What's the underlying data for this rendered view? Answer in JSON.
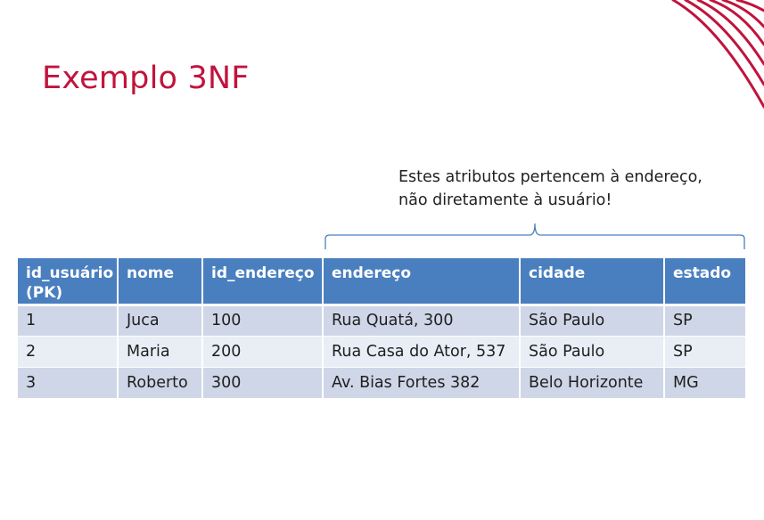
{
  "slide": {
    "title": "Exemplo 3NF",
    "annotation_lines": [
      "Estes atributos pertencem à endereço,",
      "não diretamente à usuário!"
    ],
    "colors": {
      "title": "#c0143c",
      "header_bg": "#4a7fbf",
      "row_odd": "#cfd6e7",
      "row_even": "#e9edf5",
      "brace": "#4a7fbf",
      "corner_deco": "#c0143c"
    }
  },
  "table": {
    "headers": [
      "id_usuário (PK)",
      "nome",
      "id_endereço",
      "endereço",
      "cidade",
      "estado"
    ],
    "rows": [
      [
        "1",
        "Juca",
        "100",
        "Rua Quatá, 300",
        "São Paulo",
        "SP"
      ],
      [
        "2",
        "Maria",
        "200",
        "Rua Casa do Ator, 537",
        "São Paulo",
        "SP"
      ],
      [
        "3",
        "Roberto",
        "300",
        "Av. Bias Fortes 382",
        "Belo Horizonte",
        "MG"
      ]
    ]
  }
}
